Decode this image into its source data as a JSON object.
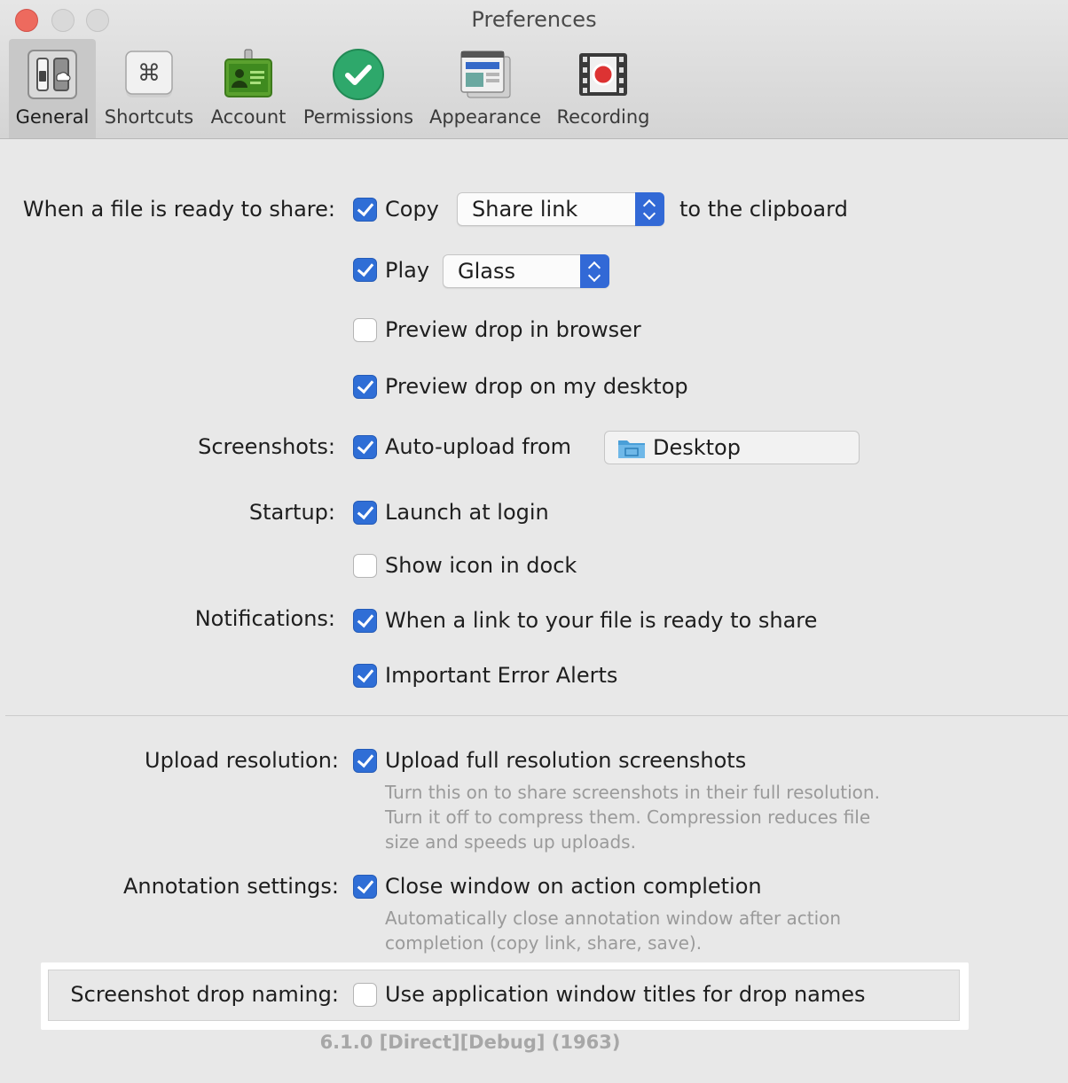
{
  "window": {
    "title": "Preferences"
  },
  "toolbar": {
    "tabs": [
      {
        "label": "General",
        "icon": "general-switch-icon",
        "active": true
      },
      {
        "label": "Shortcuts",
        "icon": "command-key-icon",
        "active": false
      },
      {
        "label": "Account",
        "icon": "id-badge-icon",
        "active": false
      },
      {
        "label": "Permissions",
        "icon": "checkmark-circle-icon",
        "active": false
      },
      {
        "label": "Appearance",
        "icon": "window-layout-icon",
        "active": false
      },
      {
        "label": "Recording",
        "icon": "film-record-icon",
        "active": false
      }
    ]
  },
  "share": {
    "label": "When a file is ready to share:",
    "copy": {
      "label": "Copy",
      "checked": true,
      "select_value": "Share link",
      "suffix": "to the clipboard"
    },
    "play": {
      "label": "Play",
      "checked": true,
      "select_value": "Glass"
    },
    "preview_browser": {
      "label": "Preview drop in browser",
      "checked": false
    },
    "preview_desktop": {
      "label": "Preview drop on my desktop",
      "checked": true
    }
  },
  "screenshots": {
    "label": "Screenshots:",
    "autoupload": {
      "label": "Auto-upload from",
      "checked": true,
      "folder": "Desktop"
    }
  },
  "startup": {
    "label": "Startup:",
    "launch": {
      "label": "Launch at login",
      "checked": true
    },
    "dock": {
      "label": "Show icon in dock",
      "checked": false
    }
  },
  "notifications": {
    "label": "Notifications:",
    "link_ready": {
      "label": "When a link to your file is ready to share",
      "checked": true
    },
    "error_alerts": {
      "label": "Important Error Alerts",
      "checked": true
    }
  },
  "upload_resolution": {
    "label": "Upload resolution:",
    "full": {
      "label": "Upload full resolution screenshots",
      "checked": true
    },
    "desc": [
      "Turn this on to share screenshots in their full resolution.",
      "Turn it off to compress them. Compression reduces file",
      "size and speeds up uploads."
    ]
  },
  "annotation": {
    "label": "Annotation settings:",
    "close_window": {
      "label": "Close window on action completion",
      "checked": true
    },
    "desc": [
      "Automatically close annotation window after action",
      "completion (copy link, share, save)."
    ]
  },
  "naming": {
    "label": "Screenshot drop naming:",
    "use_titles": {
      "label": "Use application window titles for drop names",
      "checked": false
    }
  },
  "version": "6.1.0 [Direct][Debug] (1963)",
  "colors": {
    "accent": "#2f6ed6",
    "close": "#ed6a5e",
    "subtext": "#9a9a9a"
  }
}
